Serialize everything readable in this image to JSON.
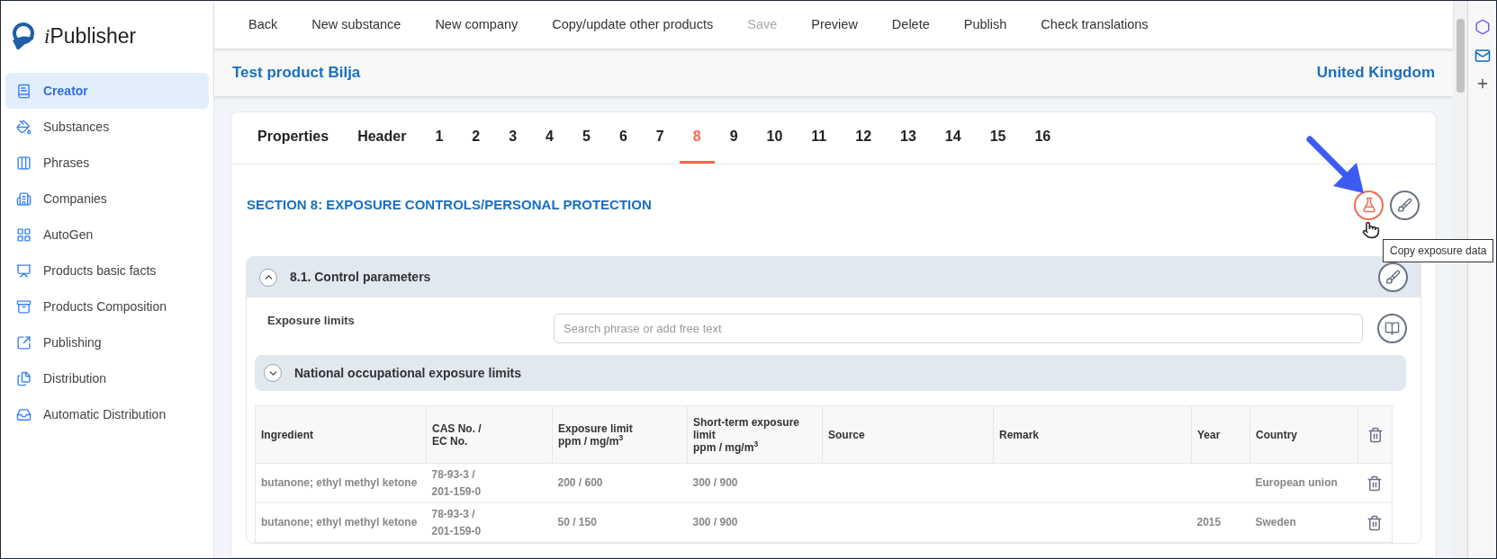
{
  "app": {
    "logo_text": "Publisher",
    "logo_prefix": "i"
  },
  "sidebar": {
    "items": [
      {
        "label": "Creator",
        "selected": true
      },
      {
        "label": "Substances",
        "selected": false
      },
      {
        "label": "Phrases",
        "selected": false
      },
      {
        "label": "Companies",
        "selected": false
      },
      {
        "label": "AutoGen",
        "selected": false
      },
      {
        "label": "Products basic facts",
        "selected": false
      },
      {
        "label": "Products Composition",
        "selected": false
      },
      {
        "label": "Publishing",
        "selected": false
      },
      {
        "label": "Distribution",
        "selected": false
      },
      {
        "label": "Automatic Distribution",
        "selected": false
      }
    ]
  },
  "toolbar": [
    {
      "label": "Back",
      "disabled": false
    },
    {
      "label": "New substance",
      "disabled": false
    },
    {
      "label": "New company",
      "disabled": false
    },
    {
      "label": "Copy/update other products",
      "disabled": false
    },
    {
      "label": "Save",
      "disabled": true
    },
    {
      "label": "Preview",
      "disabled": false
    },
    {
      "label": "Delete",
      "disabled": false
    },
    {
      "label": "Publish",
      "disabled": false
    },
    {
      "label": "Check translations",
      "disabled": false
    }
  ],
  "product": {
    "title": "Test product Bilja",
    "country": "United Kingdom"
  },
  "tabs": [
    {
      "label": "Properties",
      "selected": false
    },
    {
      "label": "Header",
      "selected": false
    },
    {
      "label": "1",
      "selected": false
    },
    {
      "label": "2",
      "selected": false
    },
    {
      "label": "3",
      "selected": false
    },
    {
      "label": "4",
      "selected": false
    },
    {
      "label": "5",
      "selected": false
    },
    {
      "label": "6",
      "selected": false
    },
    {
      "label": "7",
      "selected": false
    },
    {
      "label": "8",
      "selected": true
    },
    {
      "label": "9",
      "selected": false
    },
    {
      "label": "10",
      "selected": false
    },
    {
      "label": "11",
      "selected": false
    },
    {
      "label": "12",
      "selected": false
    },
    {
      "label": "13",
      "selected": false
    },
    {
      "label": "14",
      "selected": false
    },
    {
      "label": "15",
      "selected": false
    },
    {
      "label": "16",
      "selected": false
    }
  ],
  "section": {
    "heading": "SECTION 8: EXPOSURE CONTROLS/PERSONAL PROTECTION",
    "tooltip": "Copy exposure data"
  },
  "subsection": {
    "title": "8.1. Control parameters",
    "expanded": true
  },
  "exposure_limits": {
    "label": "Exposure limits",
    "placeholder": "Search phrase or add free text"
  },
  "national_limits": {
    "title": "National occupational exposure limits",
    "expanded": false
  },
  "table": {
    "columns": [
      "Ingredient",
      "CAS No. /\nEC No.",
      "Exposure limit\nppm / mg/m$^{3}$",
      "Short-term exposure limit\nppm / mg/m$^{3}$",
      "Source",
      "Remark",
      "Year",
      "Country"
    ],
    "rows": [
      [
        "butanone; ethyl methyl ketone",
        "78-93-3 /\n201-159-0",
        "200 / 600",
        "300 / 900",
        "",
        "",
        "",
        "European union"
      ],
      [
        "butanone; ethyl methyl ketone",
        "78-93-3 /\n201-159-0",
        "50 / 150",
        "300 / 900",
        "",
        "",
        "2015",
        "Sweden"
      ]
    ]
  }
}
